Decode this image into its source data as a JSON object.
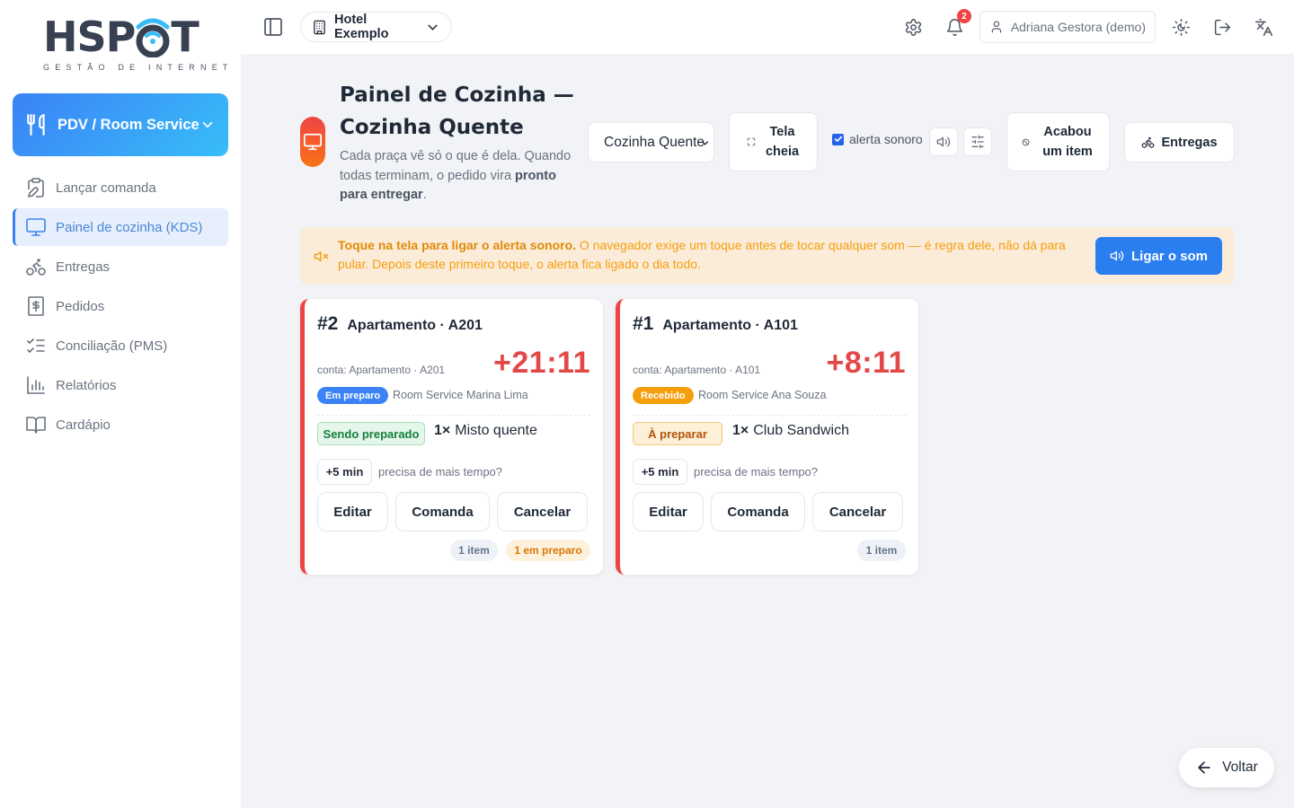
{
  "brand": {
    "name_start": "HSP",
    "name_end": "T",
    "tagline": "GESTÃO DE INTERNET"
  },
  "module": {
    "label": "PDV / Room Service"
  },
  "nav": [
    {
      "label": "Lançar comanda",
      "icon": "clipboard-edit-icon"
    },
    {
      "label": "Painel de cozinha (KDS)",
      "icon": "monitor-icon",
      "active": true
    },
    {
      "label": "Entregas",
      "icon": "bike-icon"
    },
    {
      "label": "Pedidos",
      "icon": "receipt-dollar-icon"
    },
    {
      "label": "Conciliação (PMS)",
      "icon": "list-checks-icon"
    },
    {
      "label": "Relatórios",
      "icon": "bar-chart-icon"
    },
    {
      "label": "Cardápio",
      "icon": "book-open-icon"
    }
  ],
  "topbar": {
    "hotel": "Hotel Exemplo",
    "notifications": "2",
    "user": "Adriana Gestora (demo)"
  },
  "header": {
    "title": "Painel de Cozinha — Cozinha Quente",
    "desc_1": "Cada praça vê só o que é dela. Quando todas terminam, o pedido vira ",
    "desc_bold": "pronto para entregar",
    "desc_end": ".",
    "praca": "Cozinha Quente",
    "fullscreen": "Tela cheia",
    "sound_label": "alerta sonoro",
    "finished": "Acabou um item",
    "deliveries": "Entregas"
  },
  "alert": {
    "bold": "Toque na tela para ligar o alerta sonoro.",
    "text": " O navegador exige um toque antes de tocar qualquer som — é regra dele, não dá para pular. Depois deste primeiro toque, o alerta fica ligado o dia todo.",
    "button": "Ligar o som"
  },
  "orders": [
    {
      "num": "#2",
      "title": "Apartamento · A201",
      "conta": "conta: Apartamento · A201",
      "timer": "+21:11",
      "status": "Em preparo",
      "status_color": "#3b82f6",
      "responsible": "Room Service Marina Lima",
      "item_status": "Sendo preparado",
      "item_qty": "1×",
      "item_name": "Misto quente",
      "plus": "+5 min",
      "more": "precisa de mais tempo?",
      "edit": "Editar",
      "ticket": "Comanda",
      "cancel": "Cancelar",
      "pill_items": "1 item",
      "pill_progress": "1 em preparo"
    },
    {
      "num": "#1",
      "title": "Apartamento · A101",
      "conta": "conta: Apartamento · A101",
      "timer": "+8:11",
      "status": "Recebido",
      "status_color": "#f59e0b",
      "responsible": "Room Service Ana Souza",
      "item_status": "À preparar",
      "item_qty": "1×",
      "item_name": "Club Sandwich",
      "plus": "+5 min",
      "more": "precisa de mais tempo?",
      "edit": "Editar",
      "ticket": "Comanda",
      "cancel": "Cancelar",
      "pill_items": "1 item"
    }
  ],
  "back": "Voltar"
}
